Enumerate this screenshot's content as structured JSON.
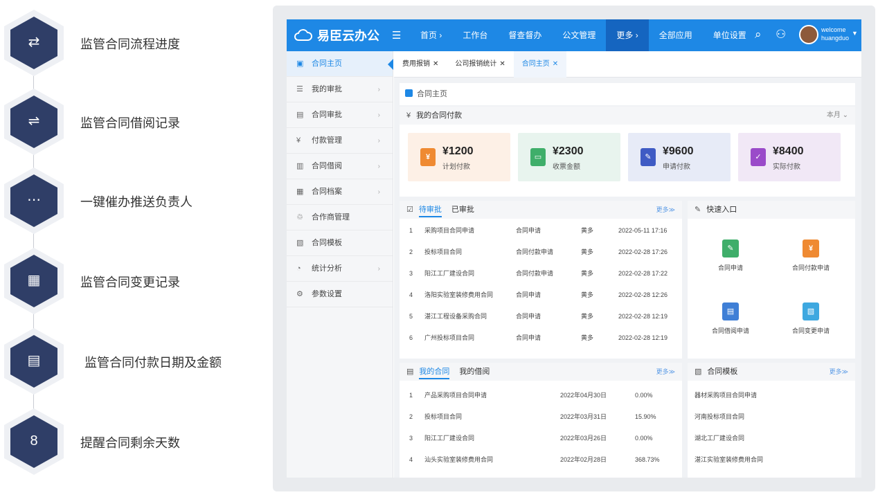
{
  "features": [
    {
      "icon": "route-icon",
      "glyph": "⇄",
      "label": "监管合同流程进度"
    },
    {
      "icon": "exchange-icon",
      "glyph": "⇌",
      "label": "监管合同借阅记录"
    },
    {
      "icon": "chat-icon",
      "glyph": "⋯",
      "label": "一键催办推送负责人"
    },
    {
      "icon": "building-icon",
      "glyph": "▦",
      "label": "监管合同变更记录"
    },
    {
      "icon": "book-icon",
      "glyph": "▤",
      "label": "监管合同付款日期及金额"
    },
    {
      "icon": "calendar-icon",
      "glyph": "8",
      "label": "提醒合同剩余天数"
    }
  ],
  "app": {
    "title": "易臣云办公",
    "nav": [
      "首页 ›",
      "工作台",
      "督查督办",
      "公文管理",
      "更多 ›",
      "全部应用",
      "单位设置"
    ],
    "user": {
      "welcome": "welcome",
      "name": "huangduo"
    },
    "colors": {
      "primary": "#1e88e5",
      "dark": "#2f3e67"
    }
  },
  "sidebar": [
    {
      "icon": "▣",
      "label": "合同主页",
      "arrow": ""
    },
    {
      "icon": "☰",
      "label": "我的审批",
      "arrow": "›"
    },
    {
      "icon": "▤",
      "label": "合同审批",
      "arrow": "›"
    },
    {
      "icon": "¥",
      "label": "付款管理",
      "arrow": "›"
    },
    {
      "icon": "▥",
      "label": "合同借阅",
      "arrow": "›"
    },
    {
      "icon": "▦",
      "label": "合同档案",
      "arrow": "›"
    },
    {
      "icon": "♲",
      "label": "合作商管理",
      "arrow": ""
    },
    {
      "icon": "▧",
      "label": "合同模板",
      "arrow": ""
    },
    {
      "icon": "◔",
      "label": "统计分析",
      "arrow": "›"
    },
    {
      "icon": "⚙",
      "label": "参数设置",
      "arrow": ""
    }
  ],
  "tabs": [
    {
      "label": "费用报销",
      "close": "✕"
    },
    {
      "label": "公司报销统计",
      "close": "✕"
    },
    {
      "label": "合同主页",
      "close": "✕"
    }
  ],
  "breadcrumb": "合同主页",
  "payments": {
    "title": "我的合同付款",
    "period": "本月 ⌄",
    "cards": [
      {
        "amount": "¥1200",
        "label": "计划付款",
        "bg": "#fdf0e6",
        "icon_bg": "#ef8a32",
        "glyph": "¥"
      },
      {
        "amount": "¥2300",
        "label": "收票金额",
        "bg": "#e8f4ee",
        "icon_bg": "#3fae6a",
        "glyph": "▭"
      },
      {
        "amount": "¥9600",
        "label": "申请付款",
        "bg": "#e7ebf7",
        "icon_bg": "#3f5bc4",
        "glyph": "✎"
      },
      {
        "amount": "¥8400",
        "label": "实际付款",
        "bg": "#f1e8f6",
        "icon_bg": "#9a4bc9",
        "glyph": "✓"
      }
    ]
  },
  "approvals": {
    "tab_active": "待审批",
    "tab_other": "已审批",
    "more": "更多≫",
    "rows": [
      {
        "no": "1",
        "name": "采购项目合同申请",
        "type": "合同申请",
        "user": "黄多",
        "time": "2022-05-11 17:16"
      },
      {
        "no": "2",
        "name": "投标项目合同",
        "type": "合同付款申请",
        "user": "黄多",
        "time": "2022-02-28 17:26"
      },
      {
        "no": "3",
        "name": "阳江工厂建设合同",
        "type": "合同付款申请",
        "user": "黄多",
        "time": "2022-02-28 17:22"
      },
      {
        "no": "4",
        "name": "洛阳实验室装修费用合同",
        "type": "合同申请",
        "user": "黄多",
        "time": "2022-02-28 12:26"
      },
      {
        "no": "5",
        "name": "湛江工程设备采购合同",
        "type": "合同申请",
        "user": "黄多",
        "time": "2022-02-28 12:19"
      },
      {
        "no": "6",
        "name": "广州投标项目合同",
        "type": "合同申请",
        "user": "黄多",
        "time": "2022-02-28 12:19"
      }
    ]
  },
  "quick": {
    "title": "快速入口",
    "items": [
      {
        "label": "合同申请",
        "bg": "#3fae6a",
        "glyph": "✎"
      },
      {
        "label": "合同付款申请",
        "bg": "#ef8a32",
        "glyph": "¥"
      },
      {
        "label": "合同借阅申请",
        "bg": "#3f7fd6",
        "glyph": "▤"
      },
      {
        "label": "合同变更申请",
        "bg": "#3ea8e0",
        "glyph": "▧"
      }
    ]
  },
  "contracts": {
    "tab_active": "我的合同",
    "tab_other": "我的借阅",
    "more": "更多≫",
    "rows": [
      {
        "no": "1",
        "name": "产品采购项目合同申请",
        "date": "2022年04月30日",
        "pct": "0.00%"
      },
      {
        "no": "2",
        "name": "投标项目合同",
        "date": "2022年03月31日",
        "pct": "15.90%"
      },
      {
        "no": "3",
        "name": "阳江工厂建设合同",
        "date": "2022年03月26日",
        "pct": "0.00%"
      },
      {
        "no": "4",
        "name": "汕头实验室装修费用合同",
        "date": "2022年02月28日",
        "pct": "368.73%"
      }
    ]
  },
  "templates": {
    "title": "合同模板",
    "more": "更多≫",
    "items": [
      "器材采购项目合同申请",
      "河南投标项目合同",
      "湖北工厂建设合同",
      "湛江实验室装修费用合同"
    ]
  }
}
